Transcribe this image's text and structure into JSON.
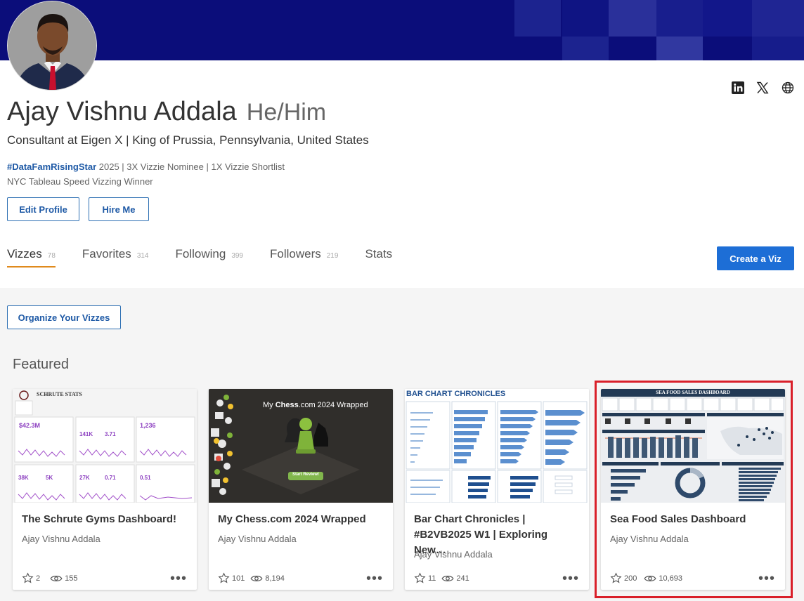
{
  "profile": {
    "name": "Ajay Vishnu Addala",
    "pronouns": "He/Him",
    "subtitle": "Consultant at Eigen X | King of Prussia, Pennsylvania, United States",
    "bio_hashtag": "#DataFamRisingStar",
    "bio_line1_rest": " 2025 | 3X Vizzie Nominee | 1X Vizzie Shortlist",
    "bio_line2": "NYC Tableau Speed Vizzing Winner",
    "edit_label": "Edit Profile",
    "hire_label": "Hire Me",
    "social_icons": [
      "linkedin-icon",
      "x-icon",
      "globe-icon"
    ]
  },
  "tabs": [
    {
      "label": "Vizzes",
      "count": "78",
      "active": true
    },
    {
      "label": "Favorites",
      "count": "314"
    },
    {
      "label": "Following",
      "count": "399"
    },
    {
      "label": "Followers",
      "count": "219"
    },
    {
      "label": "Stats",
      "count": ""
    }
  ],
  "create_label": "Create a Viz",
  "organize_label": "Organize Your Vizzes",
  "featured_label": "Featured",
  "cards": [
    {
      "title": "The Schrute Gyms Dashboard!",
      "author": "Ajay Vishnu Addala",
      "favorites": "2",
      "views": "155",
      "thumb": {
        "title": "SCHRUTE STATS",
        "metrics": [
          "$42.3M",
          "141K",
          "3.71",
          "1,236",
          "38K",
          "5K",
          "27K",
          "0.71",
          "0.51"
        ]
      }
    },
    {
      "title": "My Chess.com 2024 Wrapped",
      "author": "Ajay Vishnu Addala",
      "favorites": "101",
      "views": "8,194",
      "thumb": {
        "heading_pre": "My ",
        "heading_brand": "Chess",
        "heading_post": ".com 2024 Wrapped",
        "button": "Start Review!"
      }
    },
    {
      "title": "Bar Chart Chronicles | #B2VB2025 W1 | Exploring New…",
      "author": "Ajay Vishnu Addala",
      "favorites": "11",
      "views": "241",
      "thumb": {
        "title": "BAR CHART CHRONICLES"
      }
    },
    {
      "title": "Sea Food Sales Dashboard",
      "author": "Ajay Vishnu Addala",
      "favorites": "200",
      "views": "10,693",
      "thumb": {
        "title": "SEA FOOD SALES DASHBOARD"
      }
    }
  ],
  "colors": {
    "banner": "#0b0d7a",
    "accent": "#1d6ed6",
    "tab_underline": "#e08a1c",
    "highlight": "#d9202a"
  }
}
